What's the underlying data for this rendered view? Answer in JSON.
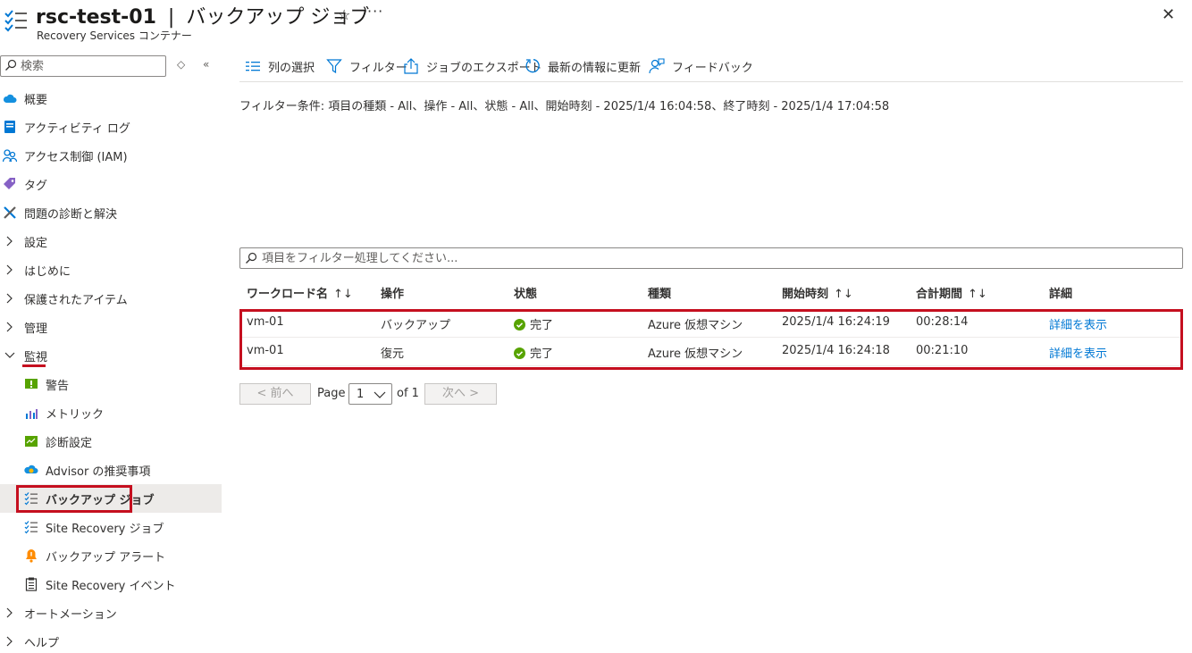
{
  "header": {
    "resource_name": "rsc-test-01",
    "separator": "|",
    "page_name": "バックアップ ジョブ",
    "subtitle": "Recovery Services コンテナー",
    "star": "☆",
    "more": "···",
    "close": "✕"
  },
  "sidebar": {
    "search_placeholder": "検索",
    "tools": [
      "◇",
      "«"
    ],
    "items": [
      {
        "label": "概要",
        "icon": "cloud-icon"
      },
      {
        "label": "アクティビティ ログ",
        "icon": "log-icon"
      },
      {
        "label": "アクセス制御 (IAM)",
        "icon": "people-icon"
      },
      {
        "label": "タグ",
        "icon": "tag-icon"
      },
      {
        "label": "問題の診断と解決",
        "icon": "wrench-icon"
      },
      {
        "label": "設定",
        "icon": "chevron-right-icon"
      },
      {
        "label": "はじめに",
        "icon": "chevron-right-icon"
      },
      {
        "label": "保護されたアイテム",
        "icon": "chevron-right-icon"
      },
      {
        "label": "管理",
        "icon": "chevron-right-icon"
      },
      {
        "label": "監視",
        "icon": "chevron-down-icon"
      },
      {
        "label": "警告",
        "icon": "alert-icon"
      },
      {
        "label": "メトリック",
        "icon": "metrics-icon"
      },
      {
        "label": "診断設定",
        "icon": "diagnostics-icon"
      },
      {
        "label": "Advisor の推奨事項",
        "icon": "advisor-icon"
      },
      {
        "label": "バックアップ ジョブ",
        "icon": "jobs-icon"
      },
      {
        "label": "Site Recovery ジョブ",
        "icon": "jobs-icon"
      },
      {
        "label": "バックアップ アラート",
        "icon": "bell-icon"
      },
      {
        "label": "Site Recovery イベント",
        "icon": "clipboard-icon"
      },
      {
        "label": "オートメーション",
        "icon": "chevron-right-icon"
      },
      {
        "label": "ヘルプ",
        "icon": "chevron-right-icon"
      }
    ]
  },
  "toolbar": {
    "columns": "列の選択",
    "filter": "フィルター",
    "export": "ジョブのエクスポート",
    "refresh": "最新の情報に更新",
    "feedback": "フィードバック"
  },
  "filter_summary": "フィルター条件: 項目の種類 - All、操作 - All、状態 - All、開始時刻 - 2025/1/4 16:04:58、終了時刻 - 2025/1/4 17:04:58",
  "filter_placeholder": "項目をフィルター処理してください...",
  "table": {
    "headers": {
      "workload": "ワークロード名",
      "operation": "操作",
      "status": "状態",
      "type": "種類",
      "start": "開始時刻",
      "duration": "合計期間",
      "details": "詳細",
      "sort": "↑↓"
    },
    "rows": [
      {
        "workload": "vm-01",
        "operation": "バックアップ",
        "status": "完了",
        "type": "Azure 仮想マシン",
        "start": "2025/1/4 16:24:19",
        "duration": "00:28:14",
        "details": "詳細を表示"
      },
      {
        "workload": "vm-01",
        "operation": "復元",
        "status": "完了",
        "type": "Azure 仮想マシン",
        "start": "2025/1/4 16:24:18",
        "duration": "00:21:10",
        "details": "詳細を表示"
      }
    ]
  },
  "pager": {
    "prev": "< 前へ",
    "page_label": "Page",
    "page_value": "1",
    "of_label": "of 1",
    "next": "次へ >"
  },
  "colors": {
    "accent": "#0078d4",
    "highlight": "#c50f1f",
    "success": "#57a300"
  }
}
